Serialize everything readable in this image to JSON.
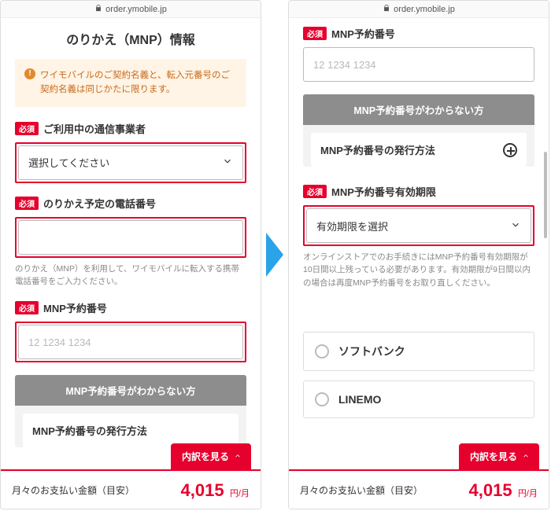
{
  "url": {
    "lock": true,
    "host": "order.ymobile.jp"
  },
  "left": {
    "title": "のりかえ（MNP）情報",
    "notice": "ワイモバイルのご契約名義と、転入元番号のご契約名義は同じかたに限ります。",
    "required_label": "必須",
    "carrier": {
      "label": "ご利用中の通信事業者",
      "value": "選択してください"
    },
    "phone": {
      "label": "のりかえ予定の電話番号",
      "value": "",
      "helper": "のりかえ（MNP）を利用して、ワイモバイルに転入する携帯電話番号をご入力ください。"
    },
    "mnp": {
      "label": "MNP予約番号",
      "placeholder": "12 1234 1234"
    },
    "infobox": {
      "head": "MNP予約番号がわからない方",
      "row": "MNP予約番号の発行方法"
    }
  },
  "right": {
    "required_label": "必須",
    "mnp": {
      "label": "MNP予約番号",
      "placeholder": "12 1234 1234"
    },
    "infobox": {
      "head": "MNP予約番号がわからない方",
      "row": "MNP予約番号の発行方法"
    },
    "expiry": {
      "label": "MNP予約番号有効期限",
      "value": "有効期限を選択",
      "helper": "オンラインストアでのお手続きにはMNP予約番号有効期限が10日間以上残っている必要があります。有効期限が9日間以内の場合は再度MNP予約番号をお取り直しください。"
    },
    "radios": [
      "ソフトバンク",
      "LINEMO"
    ]
  },
  "footer": {
    "label": "月々のお支払い金額（目安）",
    "price": "4,015",
    "unit": "円/月",
    "breakdown": "内訳を見る"
  }
}
